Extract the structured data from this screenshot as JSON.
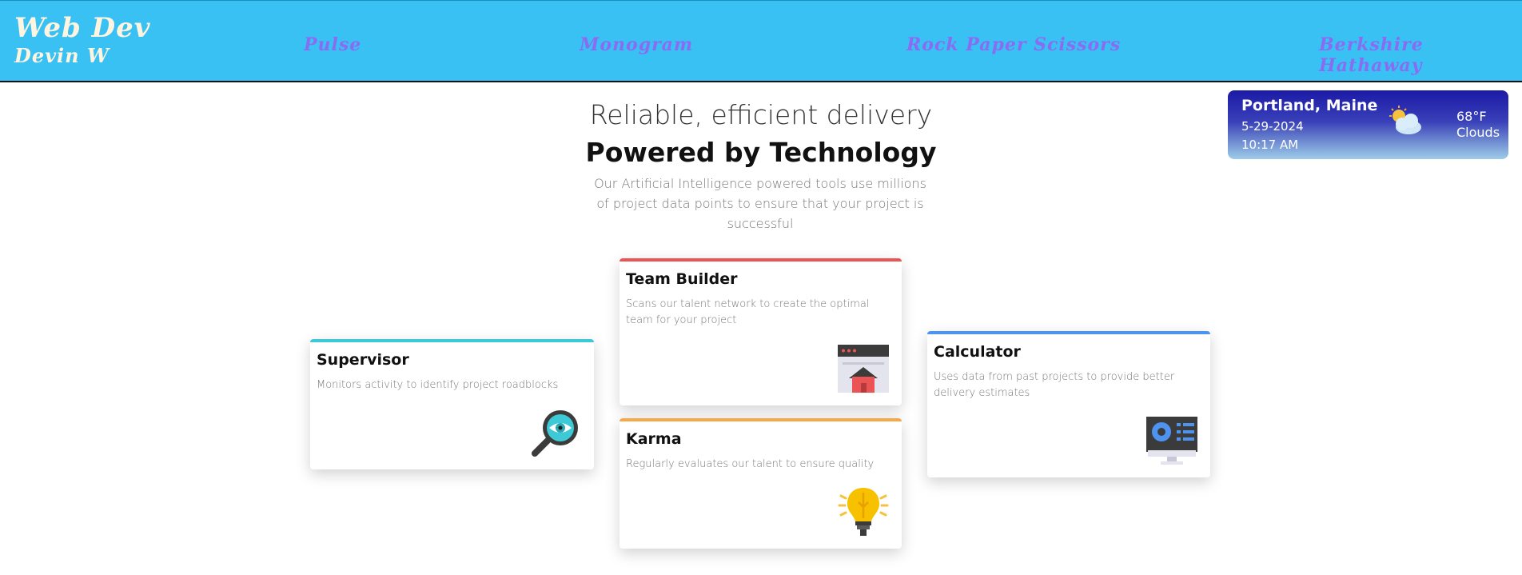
{
  "brand": {
    "title": "Web Dev",
    "subtitle": "Devin W"
  },
  "nav": [
    {
      "label": "Pulse"
    },
    {
      "label": "Monogram"
    },
    {
      "label": "Rock Paper Scissors"
    },
    {
      "label": "Berkshire Hathaway"
    }
  ],
  "weather": {
    "city": "Portland, Maine",
    "date": "5-29-2024",
    "time": "10:17 AM",
    "temp": "68°F",
    "condition": "Clouds",
    "icon": "partly-cloudy-icon"
  },
  "hero": {
    "line1": "Reliable, efficient delivery",
    "line2": "Powered by Technology",
    "desc": "Our Artificial Intelligence powered tools use millions of project data points to ensure that your project is successful"
  },
  "cards": [
    {
      "title": "Supervisor",
      "desc": "Monitors activity to identify project roadblocks",
      "accent": "#3ec9d6",
      "icon": "magnifier-eye-icon"
    },
    {
      "title": "Team Builder",
      "desc": "Scans our talent network to create the optimal team for your project",
      "accent": "#ea5455",
      "icon": "browser-house-icon"
    },
    {
      "title": "Karma",
      "desc": "Regularly evaluates our talent to ensure quality",
      "accent": "#f6a94b",
      "icon": "lightbulb-icon"
    },
    {
      "title": "Calculator",
      "desc": "Uses data from past projects to provide better delivery estimates",
      "accent": "#4f93f0",
      "icon": "monitor-chart-icon"
    }
  ],
  "colors": {
    "header_bg": "#38c1f2",
    "nav_link": "#8a6cf2",
    "brand_text": "#fff4e0"
  }
}
